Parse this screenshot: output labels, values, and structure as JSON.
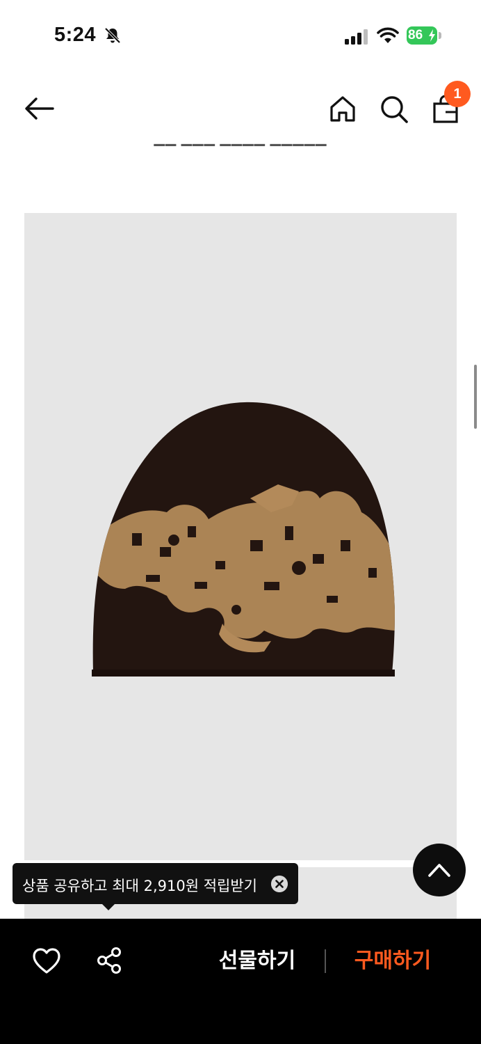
{
  "status_bar": {
    "time": "5:24",
    "battery_level": "86",
    "icons": [
      "bell-muted-icon",
      "signal-icon",
      "wifi-icon",
      "battery-charging-icon"
    ],
    "battery_color": "#34c759"
  },
  "header": {
    "icons": [
      "back-arrow-icon",
      "home-icon",
      "search-icon",
      "cart-icon"
    ],
    "cart_count": "1",
    "accent_color": "#ff5a1f"
  },
  "product": {
    "image_subject": "brown knit beanie with tan baroque pattern",
    "image_bg": "#e6e6e6"
  },
  "tooltip": {
    "text": "상품 공유하고 최대 2,910원 적립받기",
    "icon": "close-circle-icon"
  },
  "scroll_top": {
    "icon": "chevron-up-icon"
  },
  "bottom_bar": {
    "gift_label": "선물하기",
    "buy_label": "구매하기",
    "icons": [
      "heart-icon",
      "share-icon"
    ],
    "buy_color": "#ff5a1f"
  }
}
